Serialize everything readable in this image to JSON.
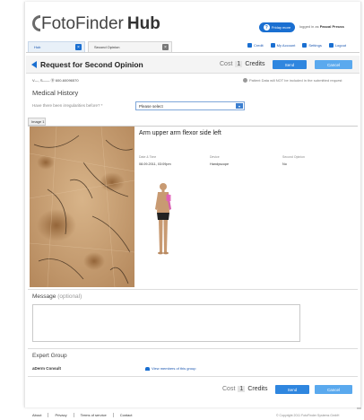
{
  "header": {
    "logo_main": "FotoFinder",
    "logo_hub": "Hub",
    "help_label": "Friday more",
    "logged_prefix": "logged in as",
    "logged_user": "Pascal Preuss"
  },
  "tabs": [
    {
      "label": "Hub",
      "close": "×"
    },
    {
      "label": "Second Opinion",
      "close": "×"
    }
  ],
  "toplinks": [
    "Credit",
    "My Account",
    "Settings",
    "Logout"
  ],
  "title_row": {
    "title": "Request for Second Opinion",
    "cost_label": "Cost",
    "cost_value": "1",
    "credits_label": "Credits",
    "send": "Send",
    "cancel": "Cancel"
  },
  "patient": {
    "info": "V—, S—— Ⓑ 600-60096570",
    "warning": "Patient Data will NOT be included in the submitted request"
  },
  "medical_history": {
    "heading": "Medical History",
    "question": "Have there been irregularities before? *",
    "select_value": "Please select"
  },
  "image": {
    "tab_label": "Image 1",
    "location": "Arm upper arm flexor side left",
    "meta": [
      {
        "label": "Date & Time",
        "value": "08.09.2011, 03:09pm"
      },
      {
        "label": "Device",
        "value": "Handyscope"
      },
      {
        "label": "Second Opinion",
        "value": "No"
      }
    ]
  },
  "message": {
    "label": "Message",
    "optional": "(optional)"
  },
  "expert_group": {
    "heading": "Expert Group",
    "name": "aDerm Consult",
    "link": "View members of this group"
  },
  "bottom_row": {
    "cost_label": "Cost",
    "cost_value": "1",
    "credits_label": "Credits",
    "send": "Send",
    "cancel": "Cancel"
  },
  "footer": {
    "links": [
      "About",
      "Privacy",
      "Terms of service",
      "Contact"
    ],
    "copyright": "© Copyright 2011 FotoFinder Systems GmbH"
  },
  "colors": {
    "accent": "#2f86df",
    "title_bg": "#f4f4f4"
  }
}
